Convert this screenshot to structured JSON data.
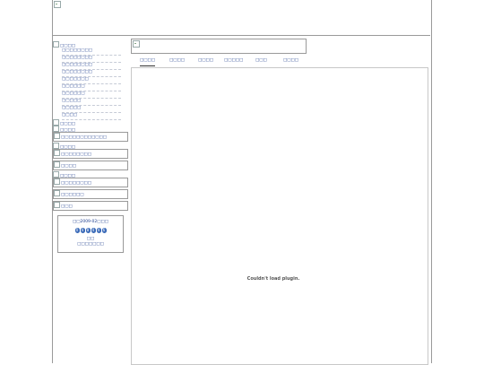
{
  "sidebar": {
    "section1_title": "□□□□",
    "sub_items": [
      "□□□□□□□□",
      "□□□□□□□□",
      "□□□□□□□□",
      "□□□□□□□□",
      "□□□□□□□",
      "□□□□□□",
      "□□□□□□",
      "□□□□□",
      "□□□□□",
      "□□□□"
    ],
    "link1": "□□□□",
    "link2": "□□□□",
    "boxed1": "□□□□□□□□□□□□",
    "link3": "□□□□",
    "boxed2": "□□□□□□□□",
    "boxed3": "□□□□",
    "link4": "□□□□",
    "boxed4": "□□□□□□□□",
    "boxed5": "□□□□□□",
    "boxed6": "□□□"
  },
  "counter": {
    "title": "□□2009-02□□□",
    "digits": [
      "0",
      "4",
      "8",
      "4",
      "4",
      "6"
    ],
    "line1": "□□",
    "line2": "□□□□□□□"
  },
  "tabs": [
    "□□□□",
    "□□□□",
    "□□□□",
    "□□□□□",
    "□□□",
    "□□□□"
  ],
  "plugin_message": "Couldn't load plugin."
}
